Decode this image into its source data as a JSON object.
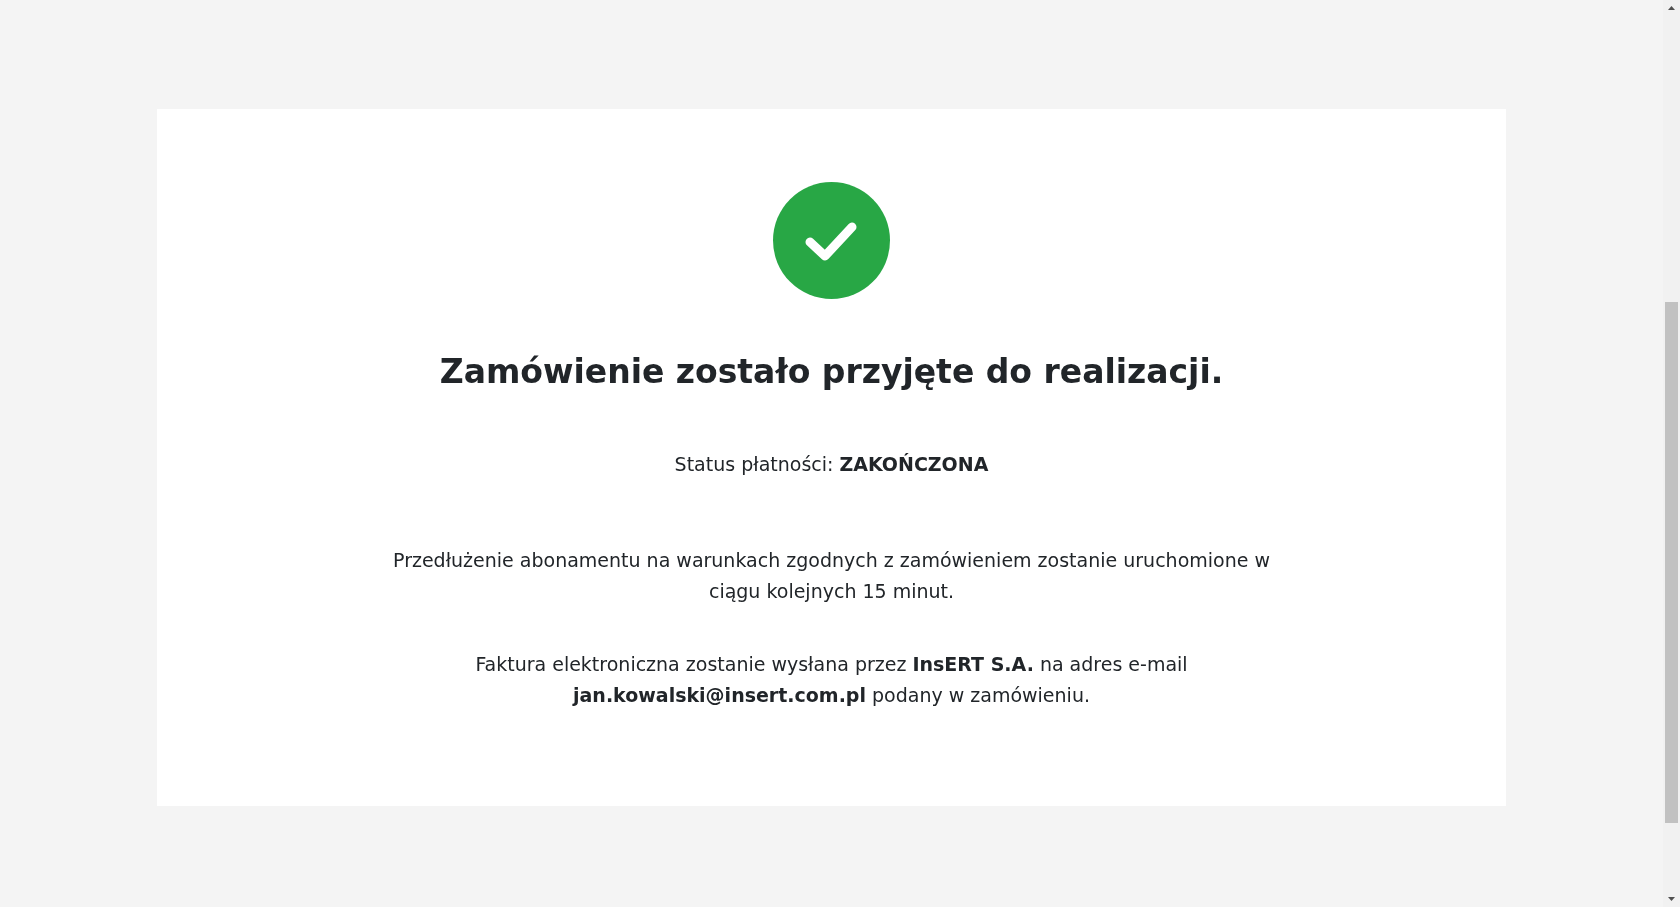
{
  "confirmation": {
    "title": "Zamówienie zostało przyjęte do realizacji.",
    "status": {
      "label": "Status płatności:",
      "value": "ZAKOŃCZONA"
    },
    "paragraphs": [
      "Przedłużenie abonamentu na warunkach zgodnych z zamówieniem zostanie uruchomione w ciągu kolejnych 15 minut.",
      "Faktura elektroniczna zostanie wysłana przez **InsERT S.A.** na adres e-mail **jan.kowalski@insert.com.pl** podany w zamówieniu."
    ]
  }
}
